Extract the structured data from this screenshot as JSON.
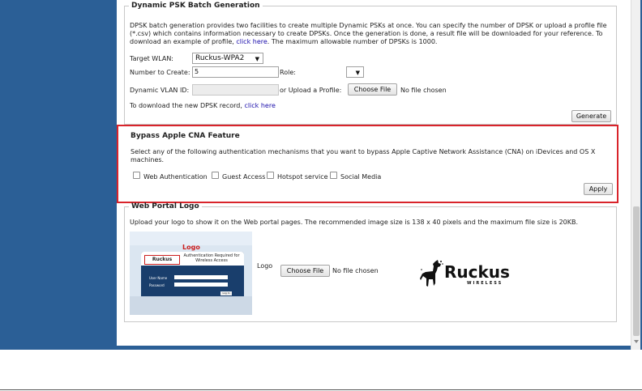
{
  "dpsk": {
    "title": "Dynamic PSK Batch Generation",
    "desc_line1": "DPSK batch generation provides two facilities to create multiple Dynamic PSKs at once. You can specify the number of DPSK or upload a profile file",
    "desc_line2": "(*.csv) which contains information necessary to create DPSKs. Once the generation is done, a result file will be downloaded for your reference. To",
    "desc_line3_pre": "download an example of profile, ",
    "desc_line3_link": "click here",
    "desc_line3_post": ". The maximum allowable number of DPSKs is 1000.",
    "target_wlan_label": "Target WLAN:",
    "target_wlan_value": "Ruckus-WPA2",
    "number_label": "Number to Create:",
    "number_value": "5",
    "role_label": "Role:",
    "role_value": "",
    "vlan_label": "Dynamic VLAN ID:",
    "vlan_value": "",
    "upload_label": "or Upload a Profile:",
    "choose_file": "Choose File",
    "no_file": "No file chosen",
    "download_pre": "To download the new DPSK record, ",
    "download_link": "click here",
    "generate_button": "Generate"
  },
  "cna": {
    "title": "Bypass Apple CNA Feature",
    "desc_line1": "Select any of the following authentication mechanisms that you want to bypass Apple Captive Network Assistance (CNA) on iDevices and OS X",
    "desc_line2": "machines.",
    "options": [
      {
        "label": "Web Authentication",
        "checked": false
      },
      {
        "label": "Guest Access",
        "checked": false
      },
      {
        "label": "Hotspot service",
        "checked": false
      },
      {
        "label": "Social Media",
        "checked": false
      }
    ],
    "apply_button": "Apply"
  },
  "portal": {
    "title": "Web Portal Logo",
    "desc": "Upload your logo to show it on the Web portal pages. The recommended image size is 138 x 40 pixels and the maximum file size is 20KB.",
    "logo_label": "Logo",
    "choose_file": "Choose File",
    "no_file": "No file chosen",
    "preview": {
      "logo_label": "Logo",
      "brand": "Ruckus",
      "auth_line1": "Authentication Required for",
      "auth_line2": "Wireless Access",
      "user_label": "User Name",
      "password_label": "Password",
      "login_button": "Log In"
    },
    "brand_logo": {
      "name": "Ruckus",
      "sub": "WIRELESS"
    }
  },
  "colors": {
    "frame": "#2b5f96",
    "highlight_border": "#d9242b",
    "link": "#1a0dab"
  }
}
